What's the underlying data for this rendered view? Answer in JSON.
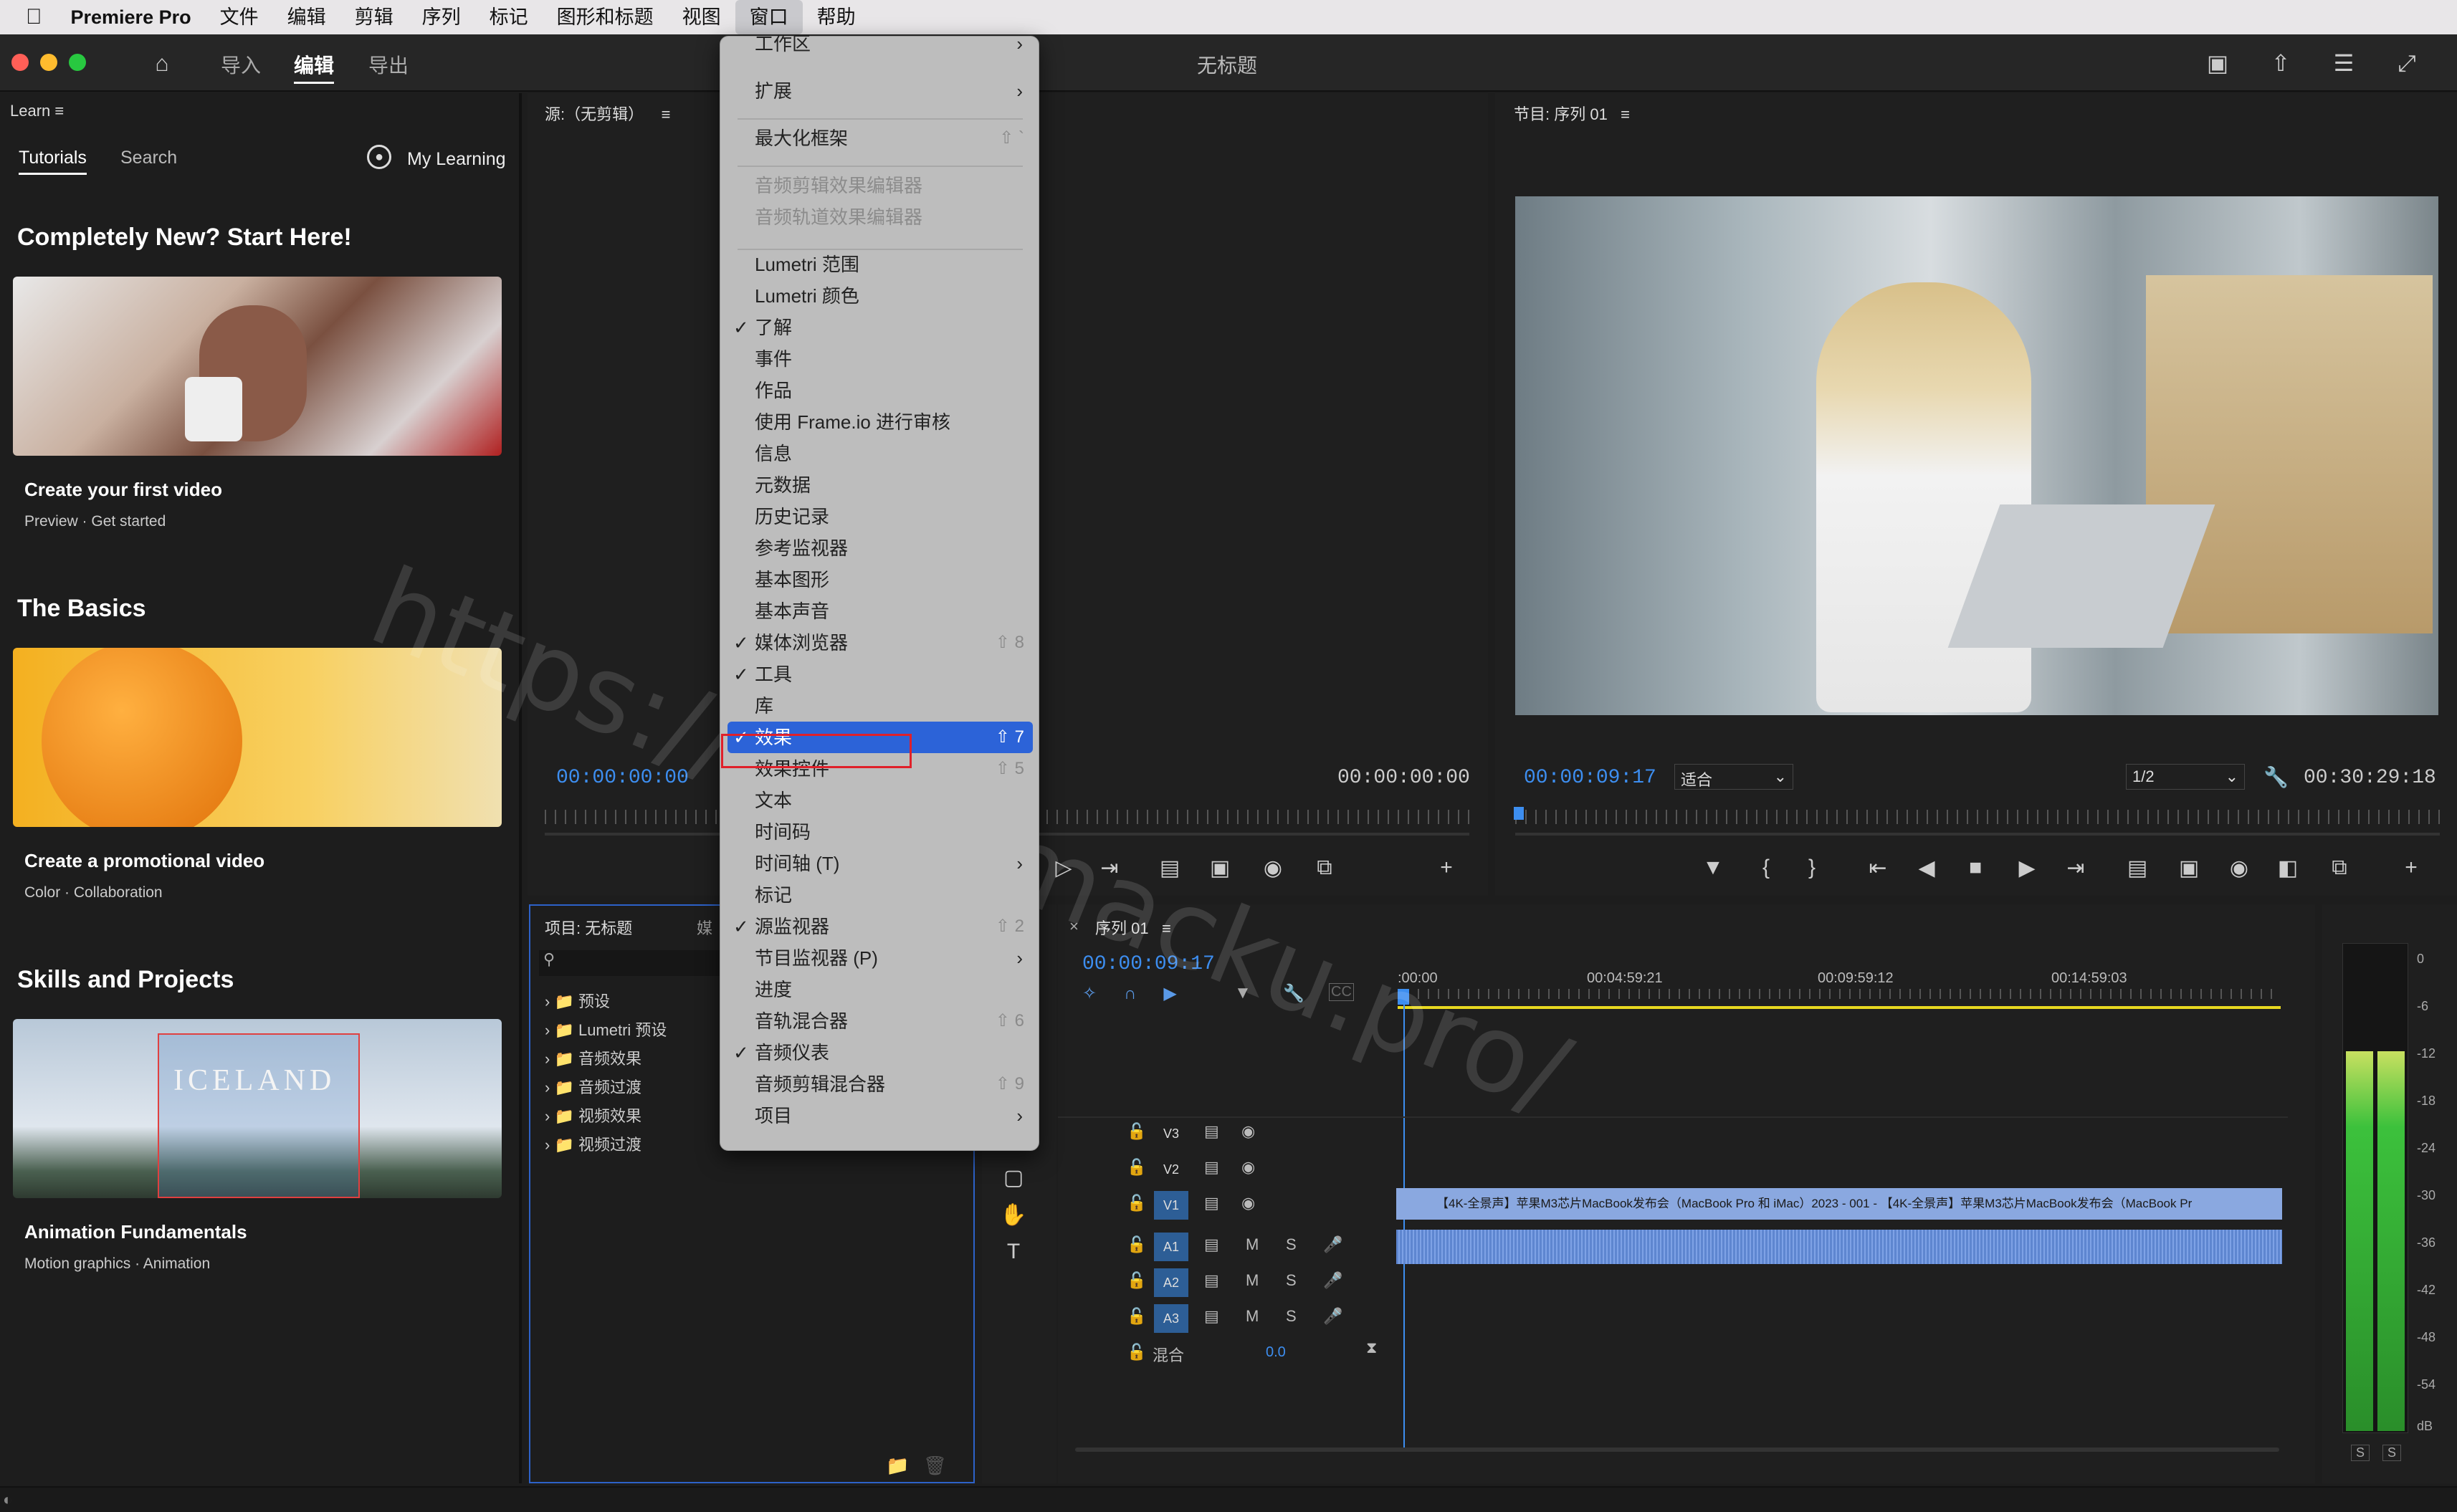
{
  "menubar": {
    "apple": "",
    "app": "Premiere Pro",
    "items": [
      "文件",
      "编辑",
      "剪辑",
      "序列",
      "标记",
      "图形和标题",
      "视图",
      "窗口",
      "帮助"
    ],
    "active": "窗口"
  },
  "titlebar": {
    "tabs": [
      "导入",
      "编辑",
      "导出"
    ],
    "active": "编辑",
    "title": "无标题"
  },
  "learn": {
    "header": "Learn",
    "tabs": [
      "Tutorials",
      "Search"
    ],
    "my_learning": "My Learning",
    "sections": [
      "Completely New? Start Here!",
      "The Basics",
      "Skills and Projects"
    ],
    "cards": [
      {
        "title": "Create your first video",
        "sub1": "Preview",
        "sub2": "Get started",
        "image": "woman-drinking-coffee"
      },
      {
        "title": "Create a promotional video",
        "sub1": "Color",
        "sub2": "Collaboration",
        "image": "orange-fruit"
      },
      {
        "title": "Animation Fundamentals",
        "sub1": "Motion graphics",
        "sub2": "Animation",
        "image": "iceland-landscape",
        "image_text": "ICELAND"
      }
    ]
  },
  "source": {
    "header": "源:（无剪辑）",
    "tc_left": "00:00:00:00",
    "tc_right": "00:00:00:00"
  },
  "program": {
    "header": "节目: 序列 01",
    "tc": "00:00:09:17",
    "fit": "适合",
    "res": "1/2",
    "duration": "00:30:29:18"
  },
  "project": {
    "header": "项目: 无标题",
    "tab2": "媒",
    "folders": [
      "预设",
      "Lumetri 预设",
      "音频效果",
      "音频过渡",
      "视频效果",
      "视频过渡"
    ]
  },
  "timeline": {
    "header": "序列 01",
    "tc": "00:00:09:17",
    "ruler": [
      ":00:00",
      "00:04:59:21",
      "00:09:59:12",
      "00:14:59:03"
    ],
    "video_tracks": [
      "V3",
      "V2",
      "V1"
    ],
    "audio_tracks": [
      "A1",
      "A2",
      "A3"
    ],
    "mix_label": "混合",
    "mix_value": "0.0",
    "track_m": "M",
    "track_s": "S",
    "clip_text": "【4K-全景声】苹果M3芯片MacBook发布会（MacBook Pro 和 iMac）2023 - 001 - 【4K-全景声】苹果M3芯片MacBook发布会（MacBook Pr"
  },
  "meter": {
    "scale": [
      "0",
      "-6",
      "-12",
      "-18",
      "-24",
      "-30",
      "-36",
      "-42",
      "-48",
      "-54",
      "dB"
    ],
    "buttons": [
      "S",
      "S"
    ]
  },
  "watermark": "https://www.macku.pro/",
  "menu": {
    "items": [
      {
        "label": "工作区",
        "type": "sub"
      },
      {
        "label": "扩展",
        "type": "sub"
      },
      {
        "label": "最大化框架",
        "shortcut": "⇧ `"
      },
      {
        "label": "音频剪辑效果编辑器",
        "type": "dis"
      },
      {
        "label": "音频轨道效果编辑器",
        "type": "dis"
      },
      {
        "label": "Lumetri 范围"
      },
      {
        "label": "Lumetri 颜色"
      },
      {
        "label": "了解",
        "checked": true
      },
      {
        "label": "事件"
      },
      {
        "label": "作品"
      },
      {
        "label": "使用 Frame.io 进行审核"
      },
      {
        "label": "信息"
      },
      {
        "label": "元数据"
      },
      {
        "label": "历史记录"
      },
      {
        "label": "参考监视器"
      },
      {
        "label": "基本图形"
      },
      {
        "label": "基本声音"
      },
      {
        "label": "媒体浏览器",
        "checked": true,
        "shortcut": "⇧ 8"
      },
      {
        "label": "工具",
        "checked": true
      },
      {
        "label": "库"
      },
      {
        "label": "效果",
        "checked": true,
        "shortcut": "⇧ 7",
        "highlighted": true
      },
      {
        "label": "效果控件",
        "shortcut": "⇧ 5"
      },
      {
        "label": "文本"
      },
      {
        "label": "时间码"
      },
      {
        "label": "时间轴 (T)",
        "type": "sub"
      },
      {
        "label": "标记"
      },
      {
        "label": "源监视器",
        "checked": true,
        "shortcut": "⇧ 2"
      },
      {
        "label": "节目监视器 (P)",
        "type": "sub"
      },
      {
        "label": "进度"
      },
      {
        "label": "音轨混合器",
        "shortcut": "⇧ 6"
      },
      {
        "label": "音频仪表",
        "checked": true
      },
      {
        "label": "音频剪辑混合器",
        "shortcut": "⇧ 9"
      },
      {
        "label": "项目",
        "type": "sub"
      }
    ]
  },
  "colors": {
    "accent": "#2c63d8",
    "timecode": "#3d8ef0",
    "clip": "#8aa8e0",
    "highlight_box": "#e0202a",
    "meter": "#3cc13c"
  }
}
